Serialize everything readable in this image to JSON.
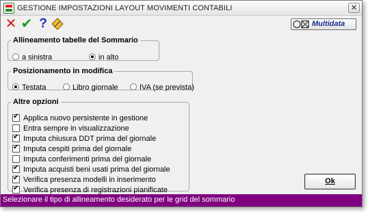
{
  "window": {
    "title": "GESTIONE IMPOSTAZIONI LAYOUT MOVIMENTI CONTABILI",
    "close_label": "✕"
  },
  "toolbar": {
    "cancel_icon": "✕",
    "confirm_icon": "✔",
    "help_icon": "?",
    "edit_icon": "edit-icon"
  },
  "brand": {
    "name": "Multidata"
  },
  "alignment": {
    "legend": "Allineamento tabelle del Sommario",
    "options": [
      {
        "label": "a sinistra",
        "selected": false
      },
      {
        "label": "in alto",
        "selected": true
      }
    ]
  },
  "positioning": {
    "legend": "Posizionamento in modifica",
    "options": [
      {
        "label": "Testata",
        "selected": true
      },
      {
        "label": "Libro giornale",
        "selected": false
      },
      {
        "label": "IVA (se prevista)",
        "selected": false
      }
    ]
  },
  "other_options": {
    "legend": "Altre opzioni",
    "items": [
      {
        "label": "Applica nuovo persistente in gestione",
        "checked": true
      },
      {
        "label": "Entra sempre in visualizzazione",
        "checked": false
      },
      {
        "label": "Imputa chiusura DDT prima del giornale",
        "checked": true
      },
      {
        "label": "Imputa cespiti prima del giornale",
        "checked": true
      },
      {
        "label": "Imputa conferimenti prima del giornale",
        "checked": false
      },
      {
        "label": "Imputa acquisti beni usati prima del giornale",
        "checked": true
      },
      {
        "label": "Verifica presenza modelli in inserimento",
        "checked": true
      },
      {
        "label": "Verifica presenza di registrazioni pianificate",
        "checked": true
      }
    ]
  },
  "ok_button": {
    "label": "Ok"
  },
  "status": {
    "text": "Selezionare il tipo di allineamento desiderato per le grid del sommario"
  },
  "colors": {
    "status_bg": "#800080",
    "brand_text": "#1a2b8c"
  }
}
